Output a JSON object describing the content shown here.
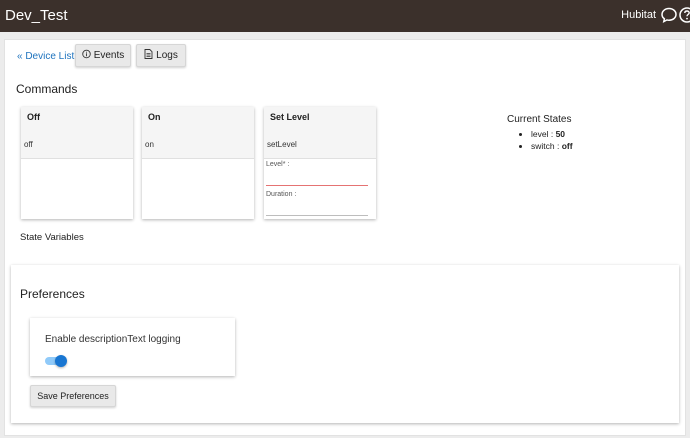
{
  "header": {
    "title": "Dev_Test",
    "brand": "Hubitat",
    "chat_icon": "chat-icon",
    "help_icon": "help-icon"
  },
  "nav": {
    "device_list_link": "« Device List",
    "events_button": "Events",
    "logs_button": "Logs"
  },
  "commands": {
    "heading": "Commands",
    "cards": [
      {
        "title": "Off",
        "method": "off"
      },
      {
        "title": "On",
        "method": "on"
      },
      {
        "title": "Set Level",
        "method": "setLevel",
        "params": [
          {
            "label": "Level* :"
          },
          {
            "label": "Duration :"
          }
        ]
      }
    ]
  },
  "current_states": {
    "title": "Current States",
    "items": [
      {
        "name": "level",
        "value": "50"
      },
      {
        "name": "switch",
        "value": "off"
      }
    ]
  },
  "state_variables": {
    "heading": "State Variables"
  },
  "preferences": {
    "heading": "Preferences",
    "option_label": "Enable descriptionText logging",
    "option_enabled": true,
    "save_button": "Save Preferences"
  },
  "colors": {
    "topbar": "#3b302b",
    "link": "#1e73be",
    "toggle_on": "#1976d2",
    "required_underline": "#e57373"
  }
}
